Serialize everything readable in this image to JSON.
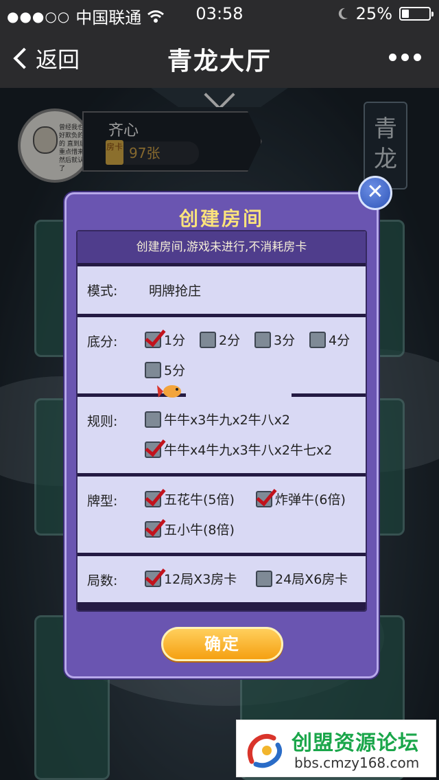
{
  "status_bar": {
    "signal": "●●●○○",
    "carrier": "中国联通",
    "time": "03:58",
    "battery": "25%",
    "battery_level": 0.25
  },
  "nav": {
    "back_label": "返回",
    "title": "青龙大厅"
  },
  "player": {
    "name": "齐心",
    "card_chip": "房卡",
    "card_count": "97张",
    "avatar_caption": "曾经我也是好欺负的 真的 直到后来重点惜来了 然后就认真了"
  },
  "hall_tag": [
    "青",
    "龙"
  ],
  "modal": {
    "title": "创建房间",
    "notice": "创建房间,游戏未进行,不消耗房卡",
    "mode": {
      "label": "模式:",
      "value": "明牌抢庄"
    },
    "base_score": {
      "label": "底分:",
      "options": [
        {
          "text": "1分",
          "checked": true
        },
        {
          "text": "2分",
          "checked": false
        },
        {
          "text": "3分",
          "checked": false
        },
        {
          "text": "4分",
          "checked": false
        },
        {
          "text": "5分",
          "checked": false
        }
      ]
    },
    "rules": {
      "label": "规则:",
      "options": [
        {
          "text": "牛牛x3牛九x2牛八x2",
          "checked": false
        },
        {
          "text": "牛牛x4牛九x3牛八x2牛七x2",
          "checked": true
        }
      ]
    },
    "card_types": {
      "label": "牌型:",
      "options": [
        {
          "text": "五花牛(5倍)",
          "checked": true
        },
        {
          "text": "炸弹牛(6倍)",
          "checked": true
        },
        {
          "text": "五小牛(8倍)",
          "checked": true
        }
      ]
    },
    "rounds": {
      "label": "局数:",
      "options": [
        {
          "text": "12局X3房卡",
          "checked": true
        },
        {
          "text": "24局X6房卡",
          "checked": false
        }
      ]
    },
    "confirm_label": "确定",
    "close_glyph": "✕"
  },
  "forum": {
    "title": "创盟资源论坛",
    "url": "bbs.cmzy168.com"
  },
  "colors": {
    "modal_bg": "#6a55b1",
    "title_gold": "#fbe37c",
    "check_red": "#c2121c",
    "confirm_orange": "#f5a012"
  }
}
